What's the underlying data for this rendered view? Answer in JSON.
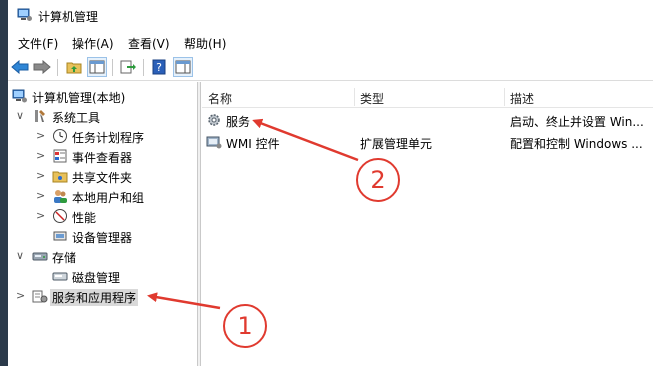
{
  "window": {
    "title": "计算机管理"
  },
  "menu": [
    {
      "label": "文件(F)"
    },
    {
      "label": "操作(A)"
    },
    {
      "label": "查看(V)"
    },
    {
      "label": "帮助(H)"
    }
  ],
  "toolbar": {
    "icons": [
      "back-arrow-icon",
      "forward-arrow-icon",
      "up-folder-icon",
      "show-hide-tree-icon",
      "export-list-icon",
      "help-icon",
      "show-action-pane-icon"
    ]
  },
  "tree": {
    "root": "计算机管理(本地)",
    "items": [
      {
        "label": "系统工具",
        "expander": "∨"
      },
      {
        "label": "任务计划程序",
        "expander": ">"
      },
      {
        "label": "事件查看器",
        "expander": ">"
      },
      {
        "label": "共享文件夹",
        "expander": ">"
      },
      {
        "label": "本地用户和组",
        "expander": ">"
      },
      {
        "label": "性能",
        "expander": ">"
      },
      {
        "label": "设备管理器",
        "expander": ""
      },
      {
        "label": "存储",
        "expander": "∨"
      },
      {
        "label": "磁盘管理",
        "expander": ""
      },
      {
        "label": "服务和应用程序",
        "expander": ">"
      }
    ]
  },
  "list": {
    "columns": [
      "名称",
      "类型",
      "描述"
    ],
    "rows": [
      {
        "name": "服务",
        "type": "",
        "desc": "启动、终止并设置 Win..."
      },
      {
        "name": "WMI 控件",
        "type": "扩展管理单元",
        "desc": "配置和控制 Windows ..."
      }
    ]
  },
  "annotations": {
    "badges": [
      "1",
      "2"
    ],
    "color": "#e03a2f"
  }
}
